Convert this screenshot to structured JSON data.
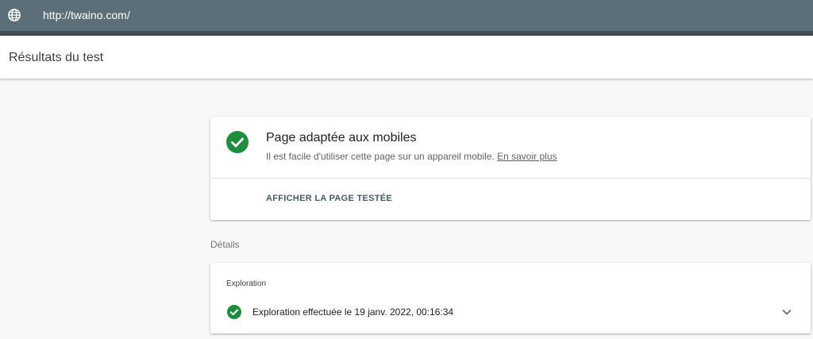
{
  "browser": {
    "url": "http://twaino.com/",
    "url_icon": "globe-icon"
  },
  "header": {
    "title": "Résultats du test"
  },
  "result": {
    "status_icon": "check-circle-icon",
    "title": "Page adaptée aux mobiles",
    "description": "Il est facile d'utiliser cette page sur un appareil mobile.",
    "learn_more": "En savoir plus",
    "view_tested_page": "AFFICHER LA PAGE TESTÉE"
  },
  "details": {
    "label": "Détails",
    "exploration": {
      "header": "Exploration",
      "status_icon": "check-circle-icon",
      "text": "Exploration effectuée le 19 janv. 2022, 00:16:34",
      "expand_icon": "chevron-down-icon"
    }
  },
  "colors": {
    "url_bar": "#5c6f79",
    "success": "#1e8e3e",
    "background": "#f8f8f8"
  }
}
